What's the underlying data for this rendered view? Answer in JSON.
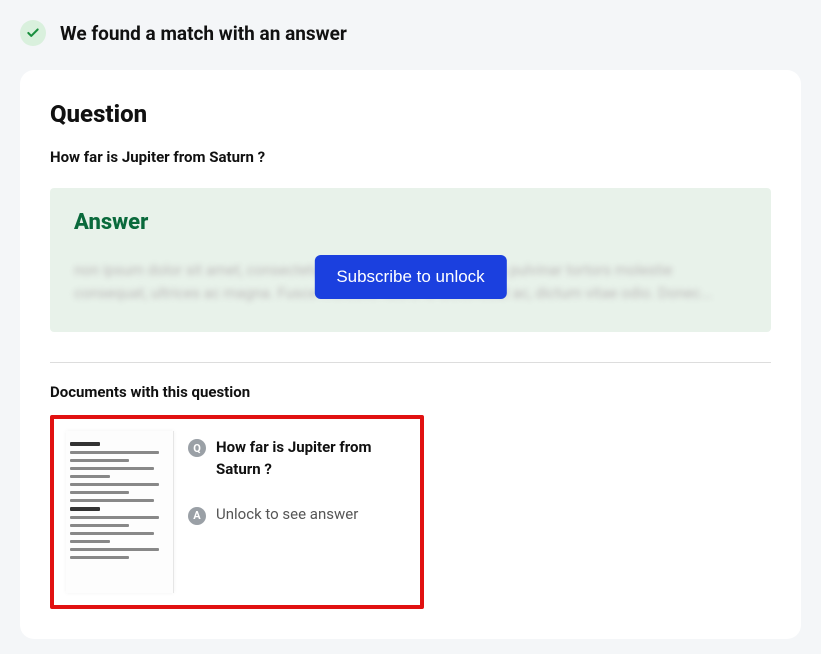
{
  "header": {
    "match_text": "We found a match with an answer"
  },
  "question": {
    "label": "Question",
    "text": "How far is Jupiter from Saturn ?"
  },
  "answer": {
    "label": "Answer",
    "placeholder_text": "non ipsum dolor sit amet, consectetur adipiscing elit. Eius tingilla pulvinar tortors molestie consequat, ultrices ac magna. Fusce molestie libero id dictenceat ac, dictum vitae odio. Donec...",
    "subscribe_label": "Subscribe to unlock"
  },
  "documents": {
    "label": "Documents with this question",
    "items": [
      {
        "question": "How far is Jupiter from Saturn ?",
        "answer_teaser": "Unlock to see answer"
      }
    ]
  },
  "badges": {
    "q": "Q",
    "a": "A"
  }
}
